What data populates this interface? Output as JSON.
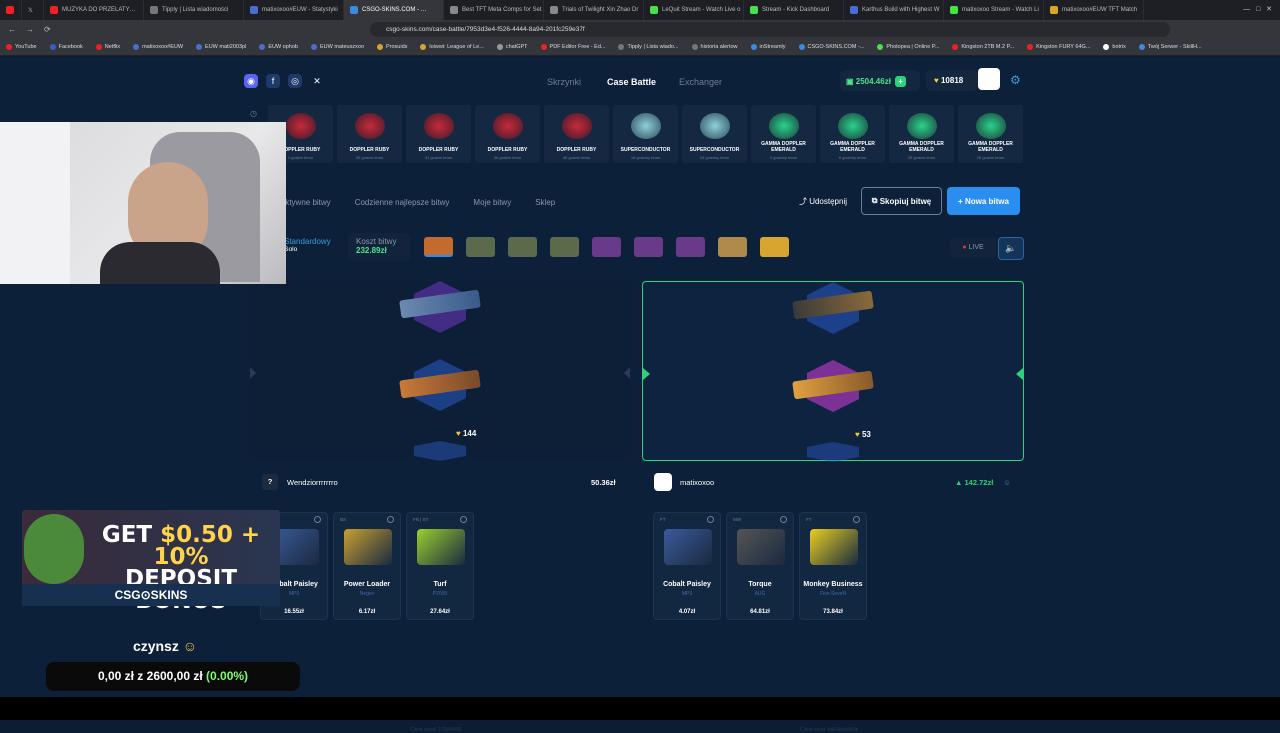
{
  "browser": {
    "tabs": [
      "",
      "",
      "MUZYKA DO PRZELATY…",
      "Tipply | Lista wiadomości",
      "matixoxoo#EUW - Statystyki",
      "CSGO-SKINS.COM - …",
      "Best TFT Meta Comps for Set",
      "Trials of Twilight Xin Zhao Dr",
      "LeQuit Stream - Watch Live o",
      "Stream - Kick Dashboard",
      "Karthus Build with Highest W",
      "matixoxoo Stream - Watch Li",
      "matixoxoo#EUW TFT Match"
    ],
    "url": "csgo-skins.com/case-battle/7953d3e4-f526-4444-8a94-201fc259e37f",
    "bookmarks": [
      "YouTube",
      "Facebook",
      "Netflix",
      "matixoxoo#EUW",
      "EUW mati2003pl",
      "EUW ophob",
      "EUW mateuszxoo",
      "Prosuids",
      "loiwwi: League of Le...",
      "chatGPT",
      "PDF Editor Free - Ed...",
      "Tipply | Lista wiado...",
      "historia alertow",
      "inStreamly",
      "CSGO-SKINS.COM -...",
      "Photopea | Online P...",
      "Kingston 2TB M.2 P...",
      "Kingston FURY 64G...",
      "botrix",
      "Twój Serwer - SkillH..."
    ]
  },
  "nav": {
    "links": [
      "Skrzynki",
      "Case Battle",
      "Exchanger"
    ],
    "balance": "2504.46zł",
    "coins": "10818"
  },
  "drops": [
    {
      "name": "DOPPLER RUBY",
      "time": "1 godzin temu",
      "color": "red"
    },
    {
      "name": "DOPPLER RUBY",
      "time": "30 godzin temu",
      "color": "red"
    },
    {
      "name": "DOPPLER RUBY",
      "time": "31 godzin temu",
      "color": "red"
    },
    {
      "name": "DOPPLER RUBY",
      "time": "36 godzin temu",
      "color": "red"
    },
    {
      "name": "DOPPLER RUBY",
      "time": "40 godzin temu",
      "color": "red"
    },
    {
      "name": "SUPERCONDUCTOR",
      "time": "18 godziny temu",
      "color": "glove"
    },
    {
      "name": "SUPERCONDUCTOR",
      "time": "24 godziny temu",
      "color": "glove"
    },
    {
      "name": "GAMMA DOPPLER EMERALD",
      "time": "3 godziny temu",
      "color": "green"
    },
    {
      "name": "GAMMA DOPPLER EMERALD",
      "time": "6 godziny temu",
      "color": "green"
    },
    {
      "name": "GAMMA DOPPLER EMERALD",
      "time": "25 godzin temu",
      "color": "green"
    },
    {
      "name": "GAMMA DOPPLER EMERALD",
      "time": "26 godzin temu",
      "color": "green"
    }
  ],
  "menu": [
    "Aktywne bitwy",
    "Codzienne najlepsze bitwy",
    "Moje bitwy",
    "Sklep"
  ],
  "actions": {
    "share": "Udostępnij",
    "copy": "Skopiuj bitwę",
    "new": "+ Nowa bitwa"
  },
  "battle": {
    "mode": "Standardowy",
    "type": "Solo",
    "cost_label": "Koszt bitwy",
    "cost": "232.89zł",
    "live": "LIVE"
  },
  "players": [
    {
      "name": "Wendziorrrrrrro",
      "total": "50.36zł",
      "score": "144",
      "items": [
        {
          "wear": "BS",
          "name": "Cobalt Paisley",
          "sub": "MP9",
          "price": "16.55zł"
        },
        {
          "wear": "BS",
          "name": "Power Loader",
          "sub": "Negev",
          "price": "6.17zł"
        },
        {
          "wear": "FN | ST",
          "name": "Turf",
          "sub": "P2000",
          "price": "27.64zł"
        }
      ]
    },
    {
      "name": "matixoxoo",
      "total": "142.72zł",
      "score": "53",
      "items": [
        {
          "wear": "FT",
          "name": "Cobalt Paisley",
          "sub": "MP9",
          "price": "4.07zł"
        },
        {
          "wear": "MW",
          "name": "Torque",
          "sub": "AUG",
          "price": "64.81zł"
        },
        {
          "wear": "FT",
          "name": "Monkey Business",
          "sub": "Five-SeveN",
          "price": "73.84zł"
        }
      ]
    }
  ],
  "overlay": {
    "promo_a": "GET ",
    "promo_b": "$0.50 + 10%",
    "promo_c": "DEPOSIT BONUS",
    "logo": "CSG⊙SKINS",
    "goal_title": "czynsz",
    "goal_current": "0,00 zł",
    "goal_sep": " z ",
    "goal_target": "2600,00 zł",
    "goal_pct": "(0.00%)"
  },
  "seeds": [
    "Client seed: 07f344992",
    "Client seed: bd34ebdd43e"
  ]
}
